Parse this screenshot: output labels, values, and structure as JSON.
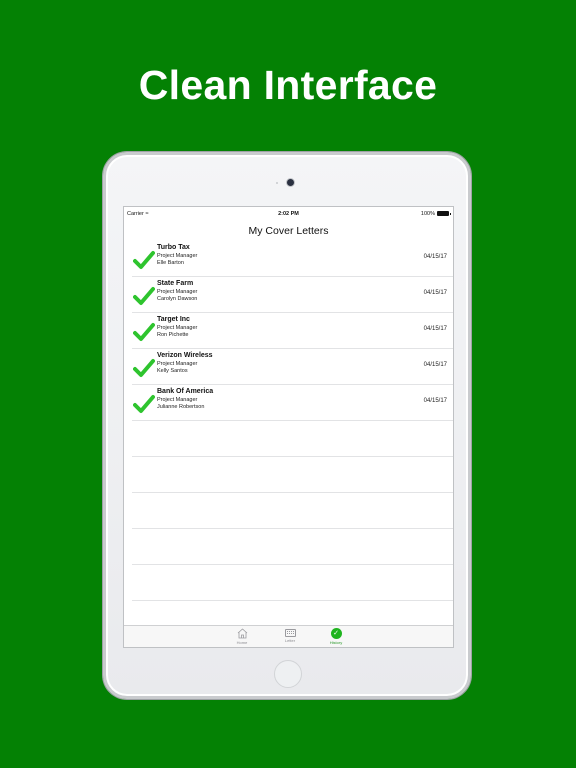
{
  "headline": "Clean Interface",
  "status_bar": {
    "carrier": "Carrier",
    "time": "2:02 PM",
    "battery": "100%"
  },
  "nav": {
    "title": "My Cover Letters"
  },
  "letters": [
    {
      "company": "Turbo Tax",
      "role": "Project Manager",
      "person": "Elle Barton",
      "date": "04/15/17"
    },
    {
      "company": "State Farm",
      "role": "Project Manager",
      "person": "Carolyn Dawson",
      "date": "04/15/17"
    },
    {
      "company": "Target Inc",
      "role": "Project Manager",
      "person": "Ron Pichette",
      "date": "04/15/17"
    },
    {
      "company": "Verizon Wireless",
      "role": "Project Manager",
      "person": "Kelly Santos",
      "date": "04/15/17"
    },
    {
      "company": "Bank Of America",
      "role": "Project Manager",
      "person": "Julianne Robertson",
      "date": "04/15/17"
    }
  ],
  "tabs": [
    {
      "label": "Home",
      "icon": "home-icon"
    },
    {
      "label": "Letter",
      "icon": "keyboard-icon"
    },
    {
      "label": "History",
      "icon": "history-icon",
      "active": true
    }
  ],
  "colors": {
    "background": "#048104",
    "check": "#2ec42e",
    "active_tab": "#1fb41f"
  }
}
